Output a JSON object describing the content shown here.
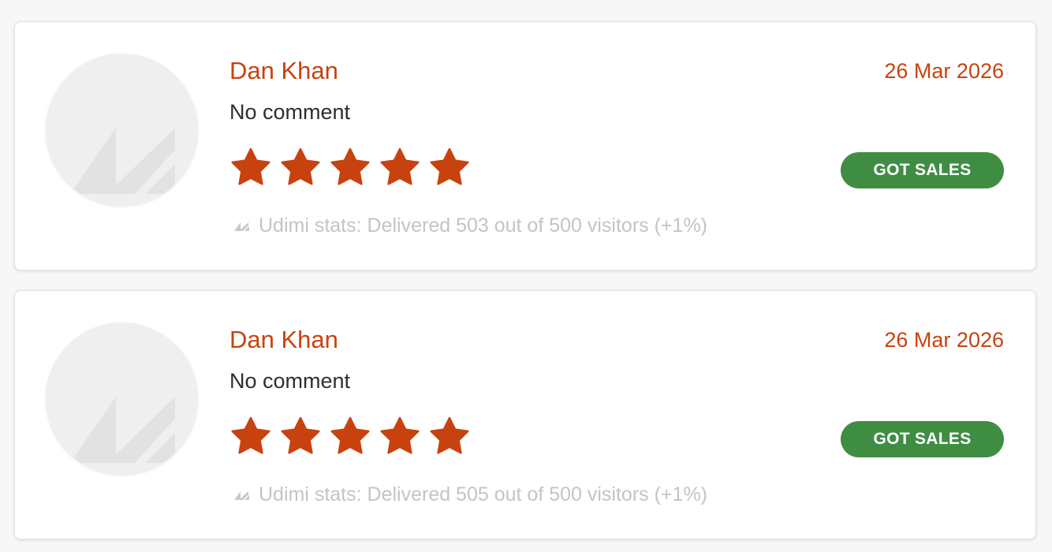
{
  "reviews": [
    {
      "reviewer_name": "Dan Khan",
      "date": "26 Mar 2026",
      "comment": "No comment",
      "rating": 5,
      "rating_max": 5,
      "badge_label": "GOT SALES",
      "stats_text": "Udimi stats: Delivered 503 out of 500 visitors (+1%)",
      "avatar_icon": "udimi-logo-placeholder-icon"
    },
    {
      "reviewer_name": "Dan Khan",
      "date": "26 Mar 2026",
      "comment": "No comment",
      "rating": 5,
      "rating_max": 5,
      "badge_label": "GOT SALES",
      "stats_text": "Udimi stats: Delivered 505 out of 500 visitors (+1%)",
      "avatar_icon": "udimi-logo-placeholder-icon"
    }
  ],
  "colors": {
    "accent": "#c8420f",
    "badge_green": "#3f8d43",
    "muted_text": "#c4c4c4",
    "card_background": "#ffffff",
    "page_background": "#f7f7f7"
  },
  "icons": {
    "star": "star-icon",
    "stats_logo": "udimi-logo-icon",
    "avatar": "udimi-logo-placeholder-icon"
  }
}
